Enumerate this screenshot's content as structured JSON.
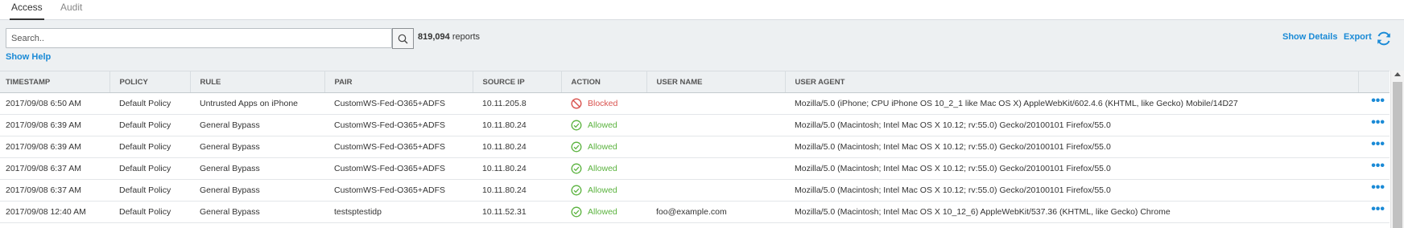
{
  "tabs": [
    {
      "label": "Access",
      "active": true
    },
    {
      "label": "Audit",
      "active": false
    }
  ],
  "toolbar": {
    "search_placeholder": "Search..",
    "report_count": "819,094",
    "report_suffix": " reports",
    "show_help": "Show Help",
    "show_details": "Show Details",
    "export": "Export",
    "icons": {
      "search": "magnifier-icon",
      "refresh": "refresh-icon"
    }
  },
  "colors": {
    "link": "#1a8ad6",
    "blocked": "#d9534f",
    "allowed": "#5bb33f",
    "toolbar_bg": "#edf0f2"
  },
  "table": {
    "columns": [
      "TIMESTAMP",
      "POLICY",
      "RULE",
      "PAIR",
      "SOURCE IP",
      "ACTION",
      "USER NAME",
      "USER AGENT",
      ""
    ],
    "rows": [
      {
        "timestamp": "2017/09/08 6:50 AM",
        "policy": "Default Policy",
        "rule": "Untrusted Apps on iPhone",
        "pair": "CustomWS-Fed-O365+ADFS",
        "source_ip": "10.11.205.8",
        "action": "Blocked",
        "action_icon": "blocked-icon",
        "user_name": "",
        "user_agent": "Mozilla/5.0 (iPhone; CPU iPhone OS 10_2_1 like Mac OS X) AppleWebKit/602.4.6 (KHTML, like Gecko) Mobile/14D27",
        "more": "•••"
      },
      {
        "timestamp": "2017/09/08 6:39 AM",
        "policy": "Default Policy",
        "rule": "General Bypass",
        "pair": "CustomWS-Fed-O365+ADFS",
        "source_ip": "10.11.80.24",
        "action": "Allowed",
        "action_icon": "allowed-check-icon",
        "user_name": "",
        "user_agent": "Mozilla/5.0 (Macintosh; Intel Mac OS X 10.12; rv:55.0) Gecko/20100101 Firefox/55.0",
        "more": "•••"
      },
      {
        "timestamp": "2017/09/08 6:39 AM",
        "policy": "Default Policy",
        "rule": "General Bypass",
        "pair": "CustomWS-Fed-O365+ADFS",
        "source_ip": "10.11.80.24",
        "action": "Allowed",
        "action_icon": "allowed-check-icon",
        "user_name": "",
        "user_agent": "Mozilla/5.0 (Macintosh; Intel Mac OS X 10.12; rv:55.0) Gecko/20100101 Firefox/55.0",
        "more": "•••"
      },
      {
        "timestamp": "2017/09/08 6:37 AM",
        "policy": "Default Policy",
        "rule": "General Bypass",
        "pair": "CustomWS-Fed-O365+ADFS",
        "source_ip": "10.11.80.24",
        "action": "Allowed",
        "action_icon": "allowed-check-icon",
        "user_name": "",
        "user_agent": "Mozilla/5.0 (Macintosh; Intel Mac OS X 10.12; rv:55.0) Gecko/20100101 Firefox/55.0",
        "more": "•••"
      },
      {
        "timestamp": "2017/09/08 6:37 AM",
        "policy": "Default Policy",
        "rule": "General Bypass",
        "pair": "CustomWS-Fed-O365+ADFS",
        "source_ip": "10.11.80.24",
        "action": "Allowed",
        "action_icon": "allowed-check-icon",
        "user_name": "",
        "user_agent": "Mozilla/5.0 (Macintosh; Intel Mac OS X 10.12; rv:55.0) Gecko/20100101 Firefox/55.0",
        "more": "•••"
      },
      {
        "timestamp": "2017/09/08 12:40 AM",
        "policy": "Default Policy",
        "rule": "General Bypass",
        "pair": "testsptestidp",
        "source_ip": "10.11.52.31",
        "action": "Allowed",
        "action_icon": "allowed-check-icon",
        "user_name": "foo@example.com",
        "user_agent": "Mozilla/5.0 (Macintosh; Intel Mac OS X 10_12_6) AppleWebKit/537.36 (KHTML, like Gecko) Chrome",
        "more": "•••"
      }
    ]
  }
}
